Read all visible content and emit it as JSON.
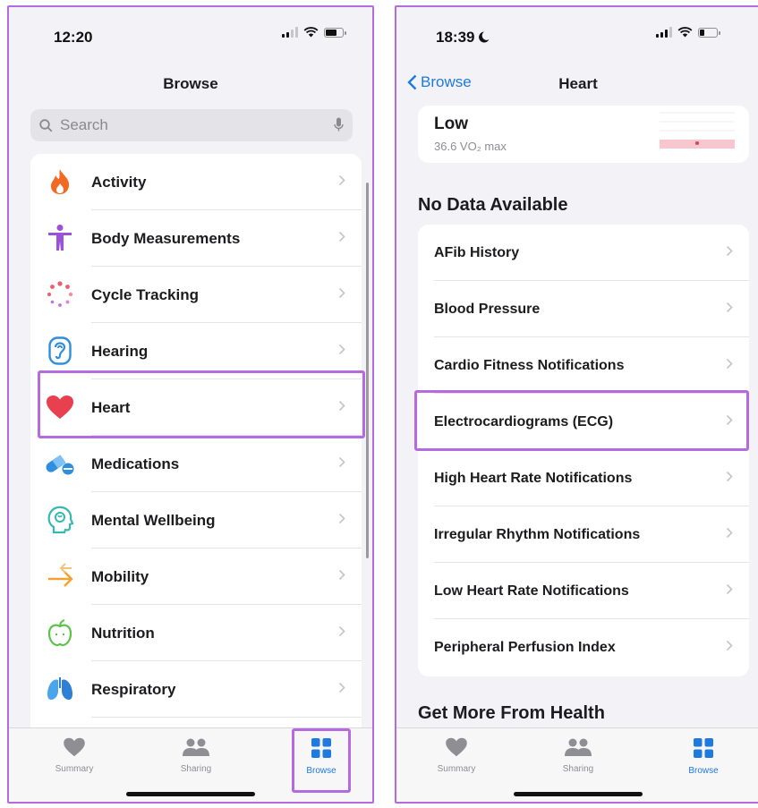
{
  "left": {
    "status_time": "12:20",
    "nav_title": "Browse",
    "search": {
      "placeholder": "Search"
    },
    "items": [
      {
        "label": "Activity"
      },
      {
        "label": "Body Measurements"
      },
      {
        "label": "Cycle Tracking"
      },
      {
        "label": "Hearing"
      },
      {
        "label": "Heart"
      },
      {
        "label": "Medications"
      },
      {
        "label": "Mental Wellbeing"
      },
      {
        "label": "Mobility"
      },
      {
        "label": "Nutrition"
      },
      {
        "label": "Respiratory"
      }
    ],
    "tabs": [
      {
        "label": "Summary",
        "icon": "heart-icon"
      },
      {
        "label": "Sharing",
        "icon": "people-icon"
      },
      {
        "label": "Browse",
        "icon": "grid-icon",
        "active": true
      }
    ]
  },
  "right": {
    "status_time": "18:39",
    "back_label": "Browse",
    "nav_title": "Heart",
    "vo2": {
      "level": "Low",
      "value": "36.6 VO₂ max"
    },
    "no_data_title": "No Data Available",
    "items": [
      {
        "label": "AFib History"
      },
      {
        "label": "Blood Pressure"
      },
      {
        "label": "Cardio Fitness Notifications"
      },
      {
        "label": "Electrocardiograms (ECG)"
      },
      {
        "label": "High Heart Rate Notifications"
      },
      {
        "label": "Irregular Rhythm Notifications"
      },
      {
        "label": "Low Heart Rate Notifications"
      },
      {
        "label": "Peripheral Perfusion Index"
      }
    ],
    "more_title": "Get More From Health",
    "tabs": [
      {
        "label": "Summary",
        "icon": "heart-icon"
      },
      {
        "label": "Sharing",
        "icon": "people-icon"
      },
      {
        "label": "Browse",
        "icon": "grid-icon",
        "active": true
      }
    ]
  },
  "colors": {
    "accent": "#1f7ae0",
    "highlight": "#b46be0",
    "heart": "#e8404f",
    "background": "#f2f2f7"
  }
}
